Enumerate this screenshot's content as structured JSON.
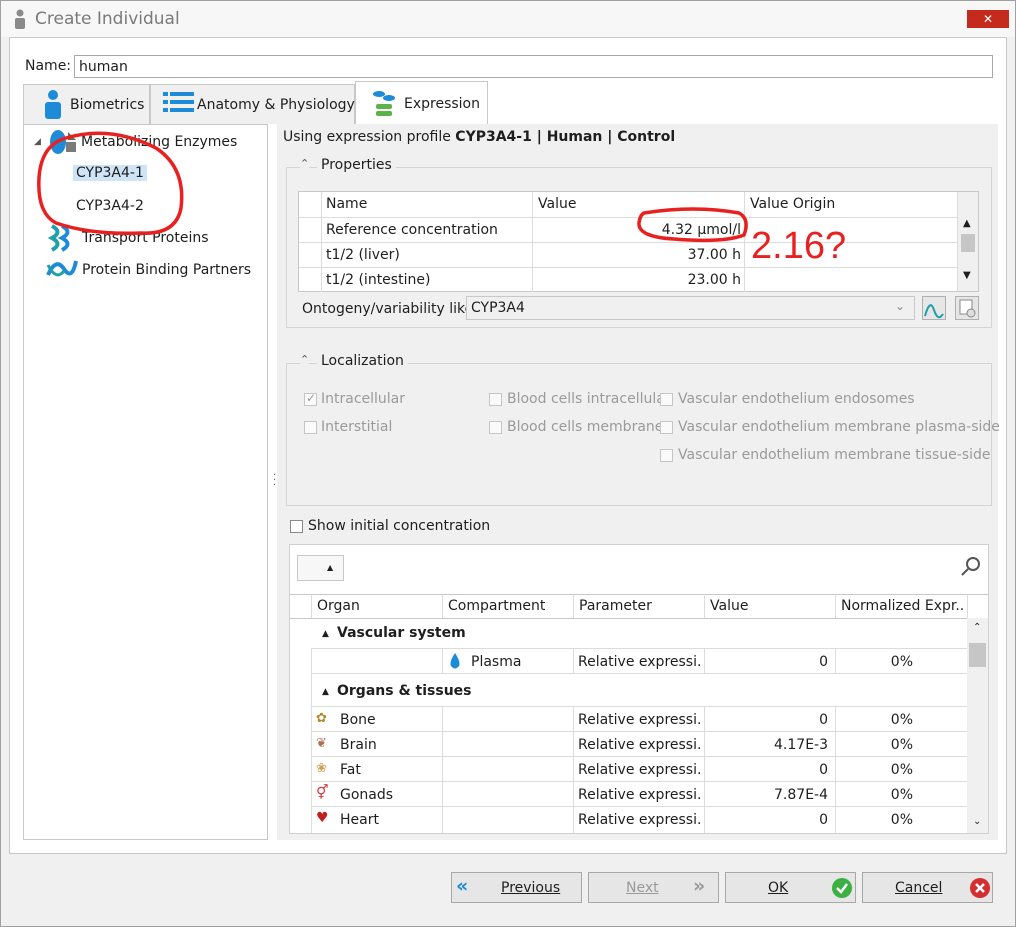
{
  "window": {
    "title": "Create Individual",
    "close": "✕"
  },
  "name_field": {
    "label": "Name:",
    "value": "human"
  },
  "tabs": [
    {
      "label": "Biometrics"
    },
    {
      "label": "Anatomy & Physiology"
    },
    {
      "label": "Expression"
    }
  ],
  "tree": {
    "root": "Metabolizing Enzymes",
    "enzymes": [
      "CYP3A4-1",
      "CYP3A4-2"
    ],
    "transport": "Transport Proteins",
    "binding": "Protein Binding Partners"
  },
  "profile": {
    "prefix": "Using expression profile",
    "name": "CYP3A4-1 | Human | Control"
  },
  "properties": {
    "title": "Properties",
    "columns": [
      "Name",
      "Value",
      "Value Origin"
    ],
    "rows": [
      {
        "name": "Reference concentration",
        "value": "4.32 µmol/l",
        "origin": ""
      },
      {
        "name": "t1/2 (liver)",
        "value": "37.00 h",
        "origin": ""
      },
      {
        "name": "t1/2 (intestine)",
        "value": "23.00 h",
        "origin": ""
      }
    ],
    "ontogeny_label": "Ontogeny/variability like:",
    "ontogeny_value": "CYP3A4"
  },
  "localization": {
    "title": "Localization",
    "items": [
      {
        "label": "Intracellular",
        "checked": true
      },
      {
        "label": "Interstitial",
        "checked": false
      },
      {
        "label": "Blood cells intracellular",
        "checked": false
      },
      {
        "label": "Blood cells membrane",
        "checked": false
      },
      {
        "label": "Vascular endothelium endosomes",
        "checked": false
      },
      {
        "label": "Vascular endothelium membrane plasma-side",
        "checked": false
      },
      {
        "label": "Vascular endothelium membrane tissue-side",
        "checked": false
      }
    ]
  },
  "show_initial": {
    "label": "Show initial concentration",
    "checked": false
  },
  "expression_grid": {
    "columns": [
      "Organ",
      "Compartment",
      "Parameter",
      "Value",
      "Normalized Expr..."
    ],
    "group1": "Vascular system",
    "group2": "Organs & tissues",
    "plasma": {
      "compartment": "Plasma",
      "parameter": "Relative expressi...",
      "value": "0",
      "norm": "0%"
    },
    "rows": [
      {
        "organ": "Bone",
        "parameter": "Relative expressi...",
        "value": "0",
        "norm": "0%"
      },
      {
        "organ": "Brain",
        "parameter": "Relative expressi...",
        "value": "4.17E-3",
        "norm": "0%"
      },
      {
        "organ": "Fat",
        "parameter": "Relative expressi...",
        "value": "0",
        "norm": "0%"
      },
      {
        "organ": "Gonads",
        "parameter": "Relative expressi...",
        "value": "7.87E-4",
        "norm": "0%"
      },
      {
        "organ": "Heart",
        "parameter": "Relative expressi...",
        "value": "0",
        "norm": "0%"
      }
    ]
  },
  "buttons": {
    "previous": "Previous",
    "next": "Next",
    "ok": "OK",
    "cancel": "Cancel"
  },
  "annotation": {
    "text": "2.16?",
    "color": "#e8201f"
  }
}
